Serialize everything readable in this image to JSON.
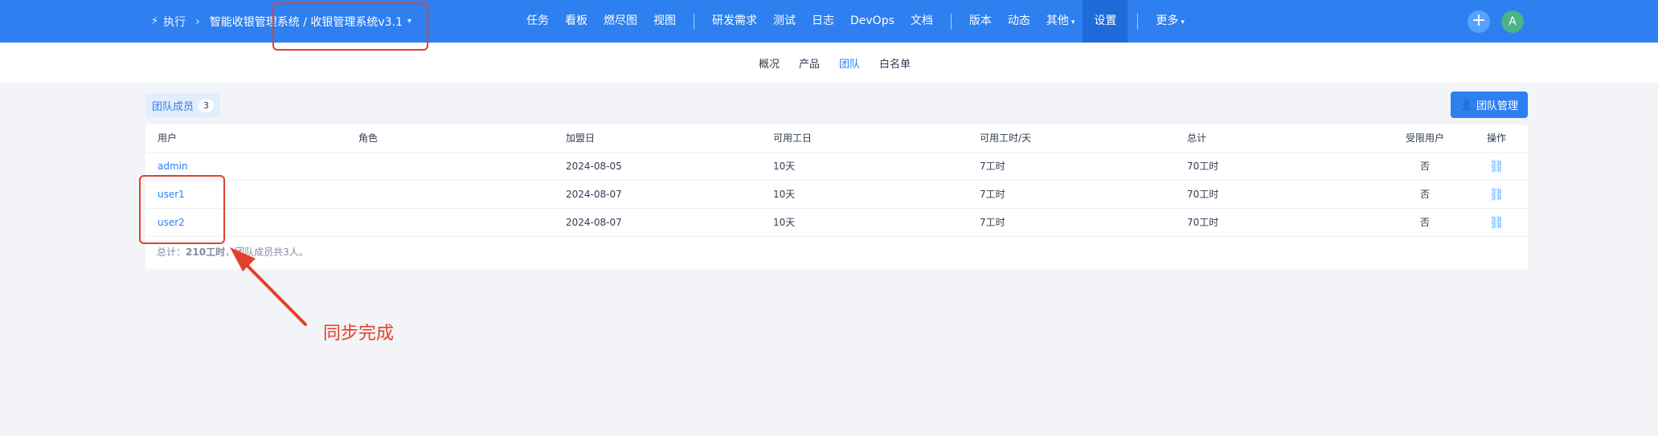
{
  "header": {
    "execute_label": "执行",
    "project_path": "智能收银管理系统 / 收银管理系统v3.1",
    "nav_items": [
      "任务",
      "看板",
      "燃尽图",
      "视图",
      "研发需求",
      "测试",
      "日志",
      "DevOps",
      "文档",
      "版本",
      "动态",
      "其他",
      "设置",
      "更多"
    ],
    "active_nav": "设置",
    "avatar_letter": "A"
  },
  "subnav": {
    "items": [
      "概况",
      "产品",
      "团队",
      "白名单"
    ],
    "active": "团队"
  },
  "team": {
    "tab_label": "团队成员",
    "member_count": "3",
    "manage_button": "团队管理"
  },
  "table": {
    "columns": [
      "用户",
      "角色",
      "加盟日",
      "可用工日",
      "可用工时/天",
      "总计",
      "受限用户",
      "操作"
    ],
    "rows": [
      {
        "user": "admin",
        "role": "",
        "join_date": "2024-08-05",
        "days": "10天",
        "hours_per_day": "7工时",
        "total": "70工时",
        "limited": "否"
      },
      {
        "user": "user1",
        "role": "",
        "join_date": "2024-08-07",
        "days": "10天",
        "hours_per_day": "7工时",
        "total": "70工时",
        "limited": "否"
      },
      {
        "user": "user2",
        "role": "",
        "join_date": "2024-08-07",
        "days": "10天",
        "hours_per_day": "7工时",
        "total": "70工时",
        "limited": "否"
      }
    ],
    "footer_prefix": "总计：",
    "footer_hours": "210工时",
    "footer_suffix": "，团队成员共3人。"
  },
  "annotation": {
    "text": "同步完成",
    "color": "#e33f2d"
  },
  "colors": {
    "primary": "#2e7ff0",
    "page_bg": "#f3f4f7"
  }
}
